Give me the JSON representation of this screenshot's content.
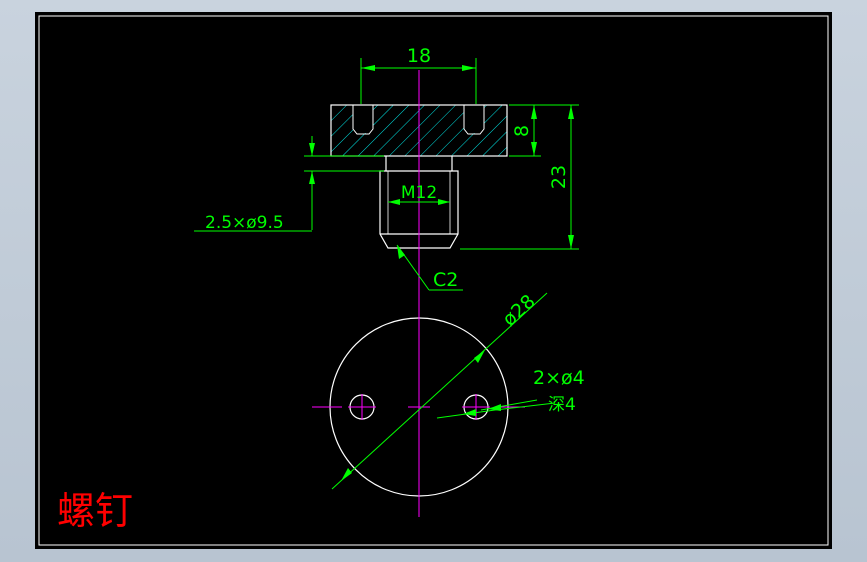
{
  "drawing": {
    "title": "螺钉",
    "colors": {
      "background": "#000000",
      "outline": "#ffffff",
      "centerline": "#ff00ff",
      "dimension": "#00ff00",
      "hatch": "#00ffff",
      "title": "#ff0000"
    },
    "dimensions": {
      "width_top": "18",
      "height_head": "8",
      "height_total": "23",
      "thread": "M12",
      "groove": "2.5×ø9.5",
      "chamfer": "C2",
      "diameter": "ø28",
      "holes": "2×ø4",
      "hole_depth": "深4"
    }
  }
}
